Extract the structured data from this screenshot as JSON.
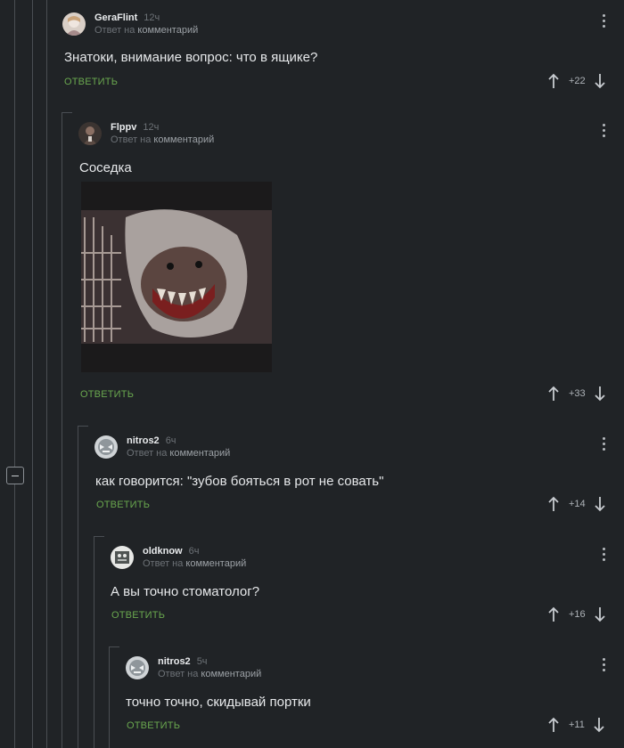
{
  "comments": [
    {
      "username": "GeraFlint",
      "time": "12ч",
      "reply_prefix": "Ответ на",
      "reply_target": "комментарий",
      "text": "Знатоки, внимание вопрос: что в ящике?",
      "reply_label": "ОТВЕТИТЬ",
      "votes": "+22"
    },
    {
      "username": "Flppv",
      "time": "12ч",
      "reply_prefix": "Ответ на",
      "reply_target": "комментарий",
      "text": "Соседка",
      "reply_label": "ОТВЕТИТЬ",
      "votes": "+33"
    },
    {
      "username": "nitros2",
      "time": "6ч",
      "reply_prefix": "Ответ на",
      "reply_target": "комментарий",
      "text": "как говорится: \"зубов бояться в рот не совать\"",
      "reply_label": "ОТВЕТИТЬ",
      "votes": "+14"
    },
    {
      "username": "oldknow",
      "time": "6ч",
      "reply_prefix": "Ответ на",
      "reply_target": "комментарий",
      "text": "А вы точно стоматолог?",
      "reply_label": "ОТВЕТИТЬ",
      "votes": "+16"
    },
    {
      "username": "nitros2",
      "time": "5ч",
      "reply_prefix": "Ответ на",
      "reply_target": "комментарий",
      "text": "точно точно, скидывай портки",
      "reply_label": "ОТВЕТИТЬ",
      "votes": "+11"
    }
  ],
  "colors": {
    "background": "#202326",
    "accent": "#6aa84f",
    "thread_line": "#4a4e53"
  },
  "icons": [
    "vote-up-icon",
    "vote-down-icon",
    "more-options-icon",
    "collapse-thread-icon"
  ]
}
